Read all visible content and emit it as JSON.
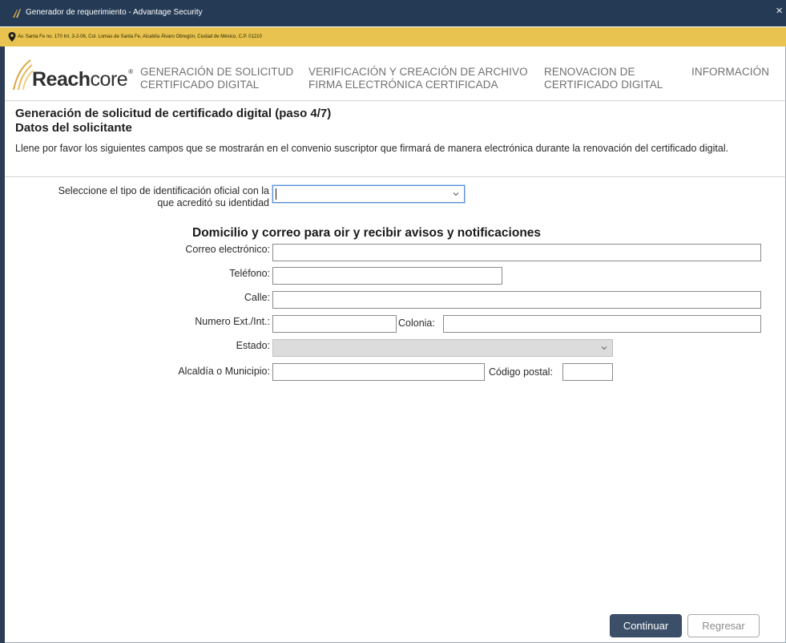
{
  "window": {
    "title": "Generador de requerimiento - Advantage Security",
    "close_glyph": "×"
  },
  "address_bar": {
    "text": "Av. Santa Fe no. 170 Int. 3-2-06, Col. Lomas de Santa Fe, Alcaldía Álvaro Obregón, Ciudad de México, C.P. 01210",
    "icon": "location-pin-icon"
  },
  "brand": {
    "name_bold": "Reach",
    "name_light": "core",
    "registered": "®"
  },
  "nav": {
    "items": [
      {
        "line1": "GENERACIÓN DE SOLICITUD",
        "line2": "CERTIFICADO DIGITAL"
      },
      {
        "line1": "VERIFICACIÓN Y CREACIÓN DE ARCHIVO",
        "line2": "FIRMA ELECTRÓNICA CERTIFICADA"
      },
      {
        "line1": "RENOVACION DE",
        "line2": "CERTIFICADO DIGITAL"
      },
      {
        "line1": "INFORMACIÓN",
        "line2": ""
      }
    ]
  },
  "page": {
    "title": "Generación de solicitud de certificado digital (paso 4/7)",
    "subtitle": "Datos del solicitante",
    "instructions": "Llene por favor los siguientes campos que se mostrarán en el convenio suscriptor que firmará de manera electrónica durante la renovación del certificado digital."
  },
  "form": {
    "id_type_label_line1": "Seleccione el tipo de identificación oficial con la",
    "id_type_label_line2": "que acreditó su identidad",
    "id_type_value": "",
    "section_heading": "Domicilio y correo para oir y recibir avisos y notificaciones",
    "email_label": "Correo electrónico:",
    "email_value": "",
    "phone_label": "Teléfono:",
    "phone_value": "",
    "street_label": "Calle:",
    "street_value": "",
    "number_label": "Numero Ext./Int.:",
    "number_value": "",
    "colonia_label": "Colonia:",
    "colonia_value": "",
    "state_label": "Estado:",
    "state_value": "",
    "municipality_label": "Alcaldía o Municipio:",
    "municipality_value": "",
    "zip_label": "Código postal:",
    "zip_value": ""
  },
  "buttons": {
    "continue_label": "Continuar",
    "back_label": "Regresar"
  },
  "colors": {
    "titlebar": "#243a55",
    "address_bar": "#e8c34f",
    "primary_button": "#3c4f69",
    "brand_gold": "#d9a53a"
  }
}
